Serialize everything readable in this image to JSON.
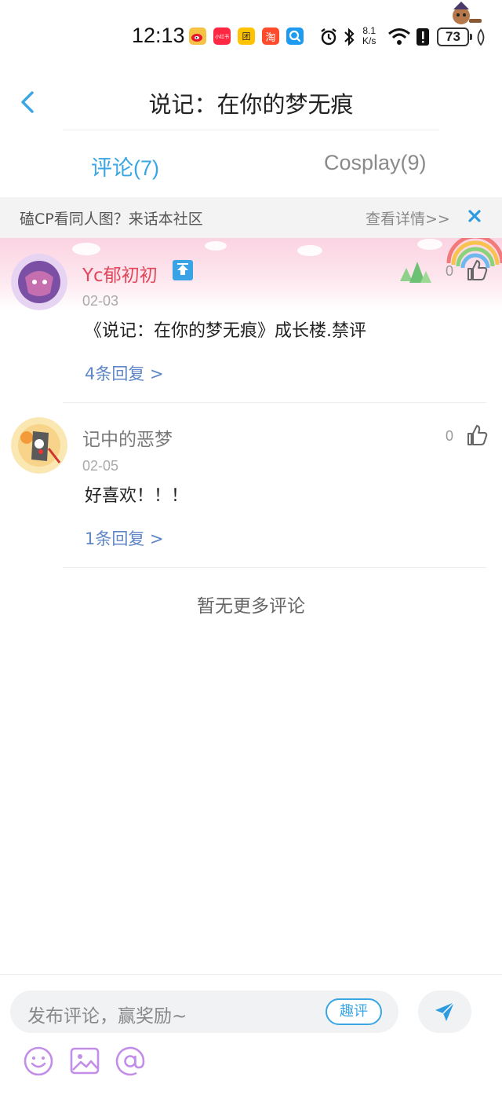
{
  "status_bar": {
    "time": "12:13",
    "app_icons": [
      {
        "name": "weibo-icon",
        "label": "微",
        "color": "#f6c244"
      },
      {
        "name": "xiaohongshu-icon",
        "label": "小红书",
        "color": "#ff2741"
      },
      {
        "name": "meituan-icon",
        "label": "团",
        "color": "#ffc300"
      },
      {
        "name": "taobao-icon",
        "label": "淘",
        "color": "#ff4b2b"
      },
      {
        "name": "search-app-icon",
        "label": "Q",
        "color": "#1e9bf0"
      }
    ],
    "net_speed_value": "8.1",
    "net_speed_unit": "K/s",
    "battery": "73"
  },
  "header": {
    "title": "说记：在你的梦无痕"
  },
  "tabs": [
    {
      "label": "评论(7)",
      "active": true
    },
    {
      "label": "Cosplay(9)",
      "active": false
    }
  ],
  "banner": {
    "text": "磕CP看同人图？来话本社区",
    "link": "查看详情>>"
  },
  "comments": [
    {
      "username": "Yc郁初初",
      "date": "02-03",
      "content": "《说记：在你的梦无痕》成长楼.禁评",
      "replies": "4条回复 >",
      "likes": "0"
    },
    {
      "username": "记中的恶梦",
      "date": "02-05",
      "content": "好喜欢！！！",
      "replies": "1条回复 >",
      "likes": "0"
    }
  ],
  "footer_note": "暂无更多评论",
  "bottom_bar": {
    "placeholder": "发布评论，赢奖励~",
    "quping_label": "趣评"
  },
  "colors": {
    "accent": "#3aa6e3",
    "username_highlight": "#e0475b",
    "reply_link": "#5f86c7"
  }
}
